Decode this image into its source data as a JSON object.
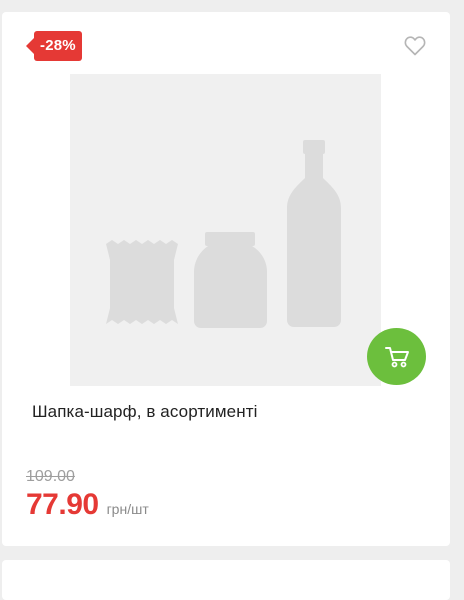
{
  "product": {
    "discount_badge": "-28%",
    "title": "Шапка-шарф, в асортименті",
    "old_price": "109.00",
    "new_price": "77.90",
    "unit": "грн/шт"
  },
  "icons": {
    "favorite": "heart-outline-icon",
    "cart": "shopping-cart-icon",
    "image_placeholder": "product-placeholder-icon"
  },
  "colors": {
    "discount": "#e53935",
    "cart_button": "#6cbf3d",
    "placeholder_bg": "#f0f0f0",
    "placeholder_fg": "#dcdcdc"
  }
}
